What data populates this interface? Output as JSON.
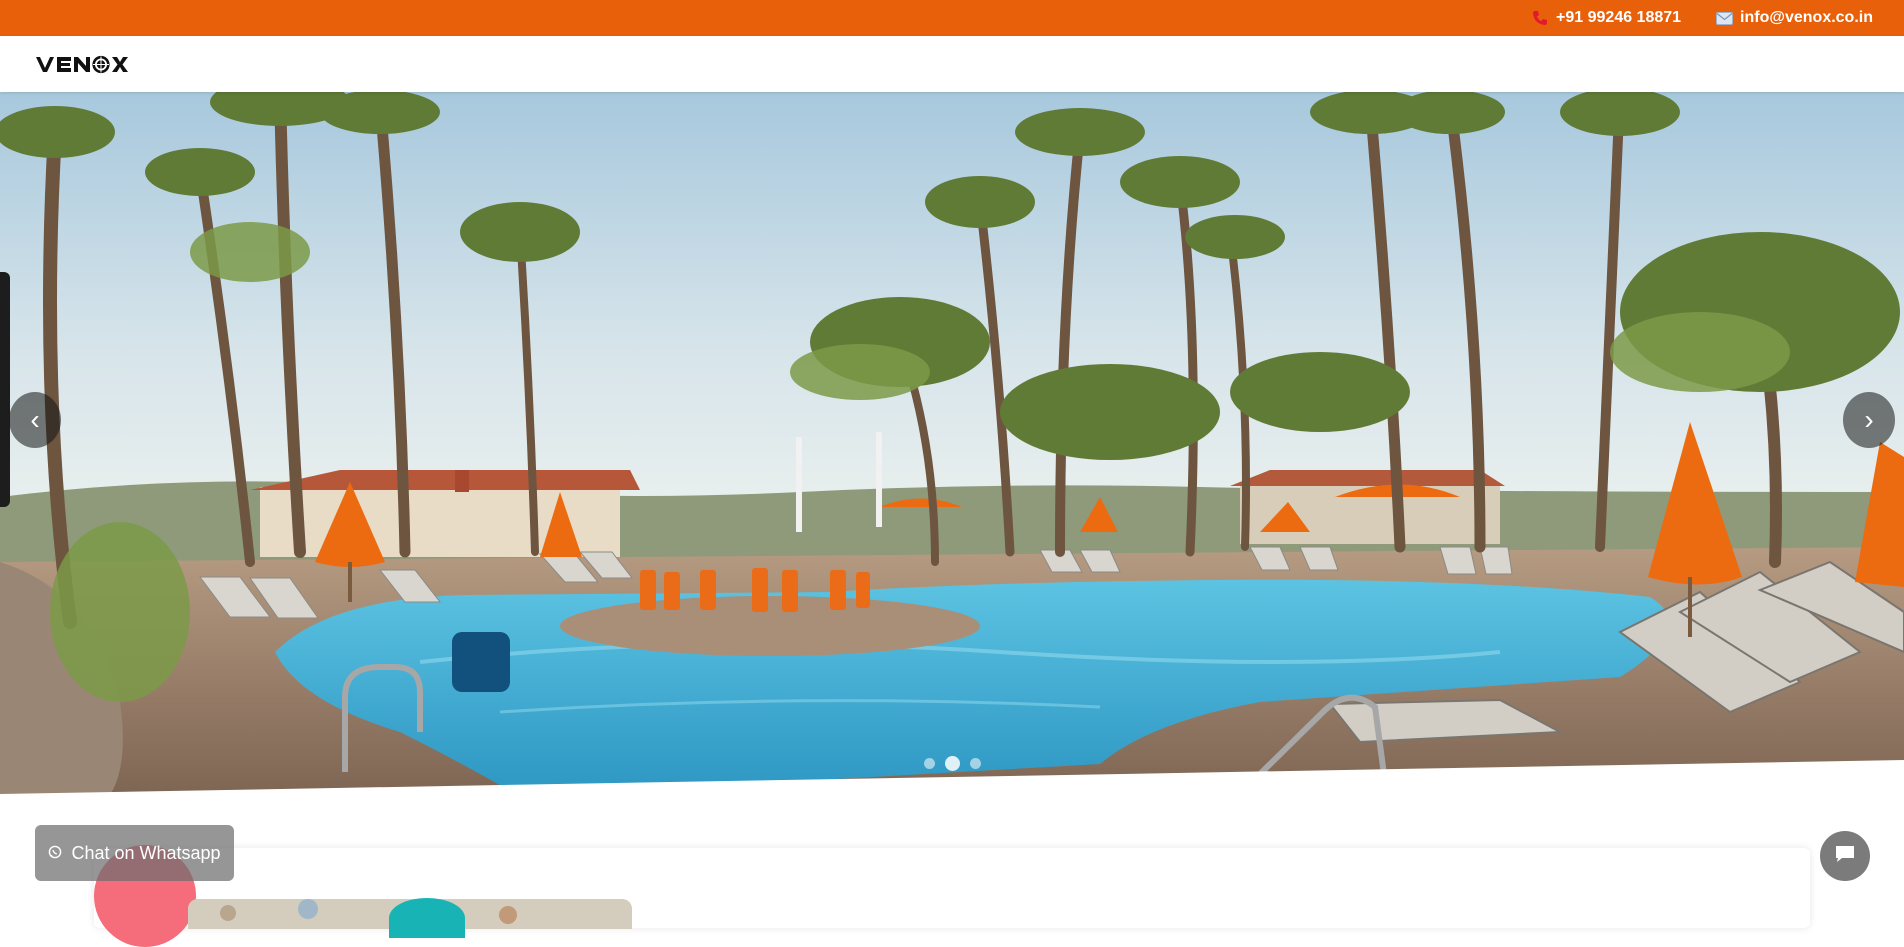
{
  "topbar": {
    "phone_icon": "phone-icon",
    "phone": "+91 99246 18871",
    "email_icon": "mail-icon",
    "email": "info@venox.co.in",
    "background_color": "#e8600a"
  },
  "header": {
    "logo_text": "venox"
  },
  "hero": {
    "prev_label": "‹",
    "next_label": "›",
    "slide_count": 3,
    "active_slide": 2
  },
  "whatsapp": {
    "icon": "whatsapp-icon",
    "label": "Chat on Whatsapp"
  },
  "chat": {
    "icon": "chat-bubble-icon"
  }
}
